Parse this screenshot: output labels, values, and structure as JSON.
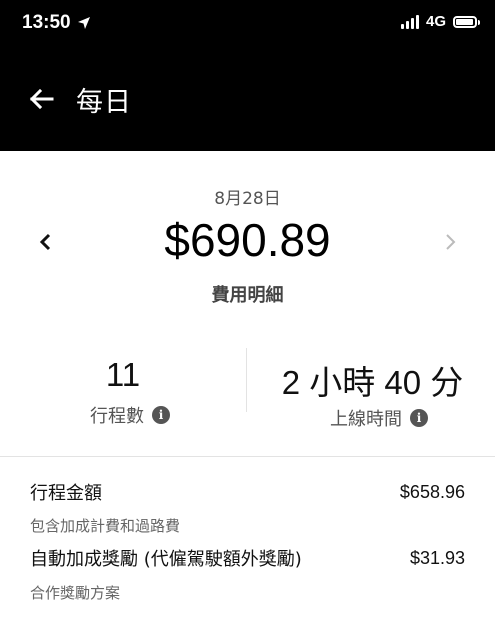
{
  "status_bar": {
    "time": "13:50",
    "network": "4G"
  },
  "header": {
    "title": "每日"
  },
  "summary": {
    "date": "8月28日",
    "amount": "$690.89",
    "breakdown_label": "費用明細"
  },
  "stats": {
    "trips_value": "11",
    "trips_label": "行程數",
    "online_value": "2 小時 40 分",
    "online_label": "上線時間"
  },
  "breakdown": [
    {
      "title": "行程金額",
      "subtitle": "包含加成計費和過路費",
      "value": "$658.96"
    },
    {
      "title": "自動加成獎勵 (代僱駕駛額外獎勵)",
      "subtitle": "合作獎勵方案",
      "value": "$31.93"
    }
  ],
  "colors": {
    "header_bg": "#000000",
    "background": "#ffffff",
    "muted_text": "#555555"
  }
}
